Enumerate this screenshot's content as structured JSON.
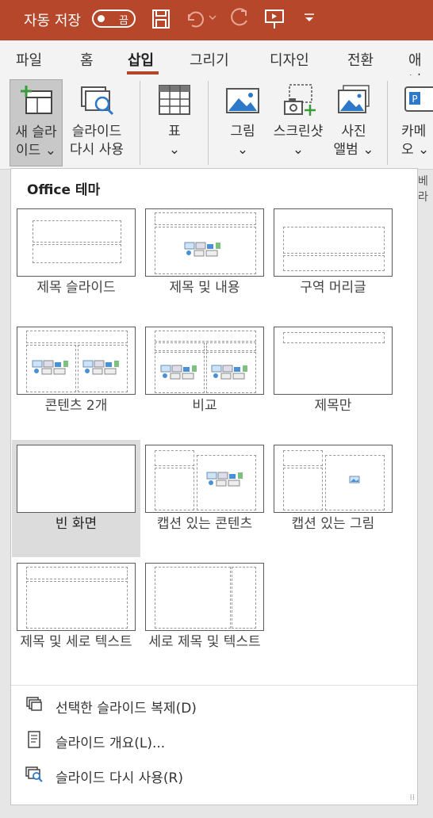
{
  "titlebar": {
    "autosave_label": "자동 저장",
    "toggle_state": "끔",
    "accent": "#b7472a"
  },
  "tabs": [
    {
      "label": "파일",
      "active": false
    },
    {
      "label": "홈",
      "active": false
    },
    {
      "label": "삽입",
      "active": true
    },
    {
      "label": "그리기",
      "active": false
    },
    {
      "label": "디자인",
      "active": false
    },
    {
      "label": "전환",
      "active": false
    },
    {
      "label": "애니",
      "active": false
    }
  ],
  "ribbon": {
    "new_slide": {
      "line1": "새 슬라",
      "line2": "이드 ⌄"
    },
    "reuse_slides": {
      "line1": "슬라이드",
      "line2": "다시 사용"
    },
    "table": {
      "line1": "표",
      "line2": "⌄"
    },
    "picture": {
      "line1": "그림",
      "line2": "⌄"
    },
    "screenshot": {
      "line1": "스크린샷",
      "line2": "⌄"
    },
    "photo_album": {
      "line1": "사진",
      "line2": "앨범 ⌄"
    },
    "camera": {
      "line1": "카메",
      "line2": "오 ⌄"
    },
    "group_fragment": "베라"
  },
  "dropdown": {
    "title": "Office 테마",
    "layouts": [
      {
        "name": "제목 슬라이드"
      },
      {
        "name": "제목 및 내용"
      },
      {
        "name": "구역 머리글"
      },
      {
        "name": "콘텐츠 2개"
      },
      {
        "name": "비교"
      },
      {
        "name": "제목만"
      },
      {
        "name": "빈 화면"
      },
      {
        "name": "캡션 있는 콘텐츠"
      },
      {
        "name": "캡션 있는 그림"
      },
      {
        "name": "제목 및 세로 텍스트"
      },
      {
        "name": "세로 제목 및 텍스트"
      }
    ],
    "commands": [
      {
        "label": "선택한 슬라이드 복제(D)"
      },
      {
        "label": "슬라이드 개요(L)..."
      },
      {
        "label": "슬라이드 다시 사용(R)"
      }
    ]
  }
}
